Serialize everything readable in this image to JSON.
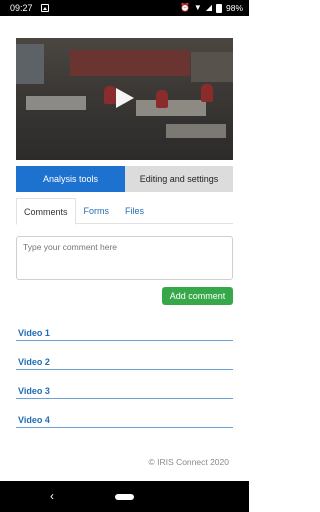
{
  "status_bar": {
    "time": "09:27",
    "battery": "98%"
  },
  "video": {
    "play_icon": "play-icon"
  },
  "tabs": {
    "primary": "Analysis tools",
    "secondary": "Editing and settings"
  },
  "subtabs": [
    "Comments",
    "Forms",
    "Files"
  ],
  "comment": {
    "placeholder": "Type your comment here",
    "button": "Add comment"
  },
  "videos": [
    "Video 1",
    "Video 2",
    "Video 3",
    "Video 4"
  ],
  "footer": "© IRIS Connect 2020",
  "colors": {
    "primary_tab": "#1d72d0",
    "add_button": "#37a84a",
    "link": "#1f6db5"
  }
}
